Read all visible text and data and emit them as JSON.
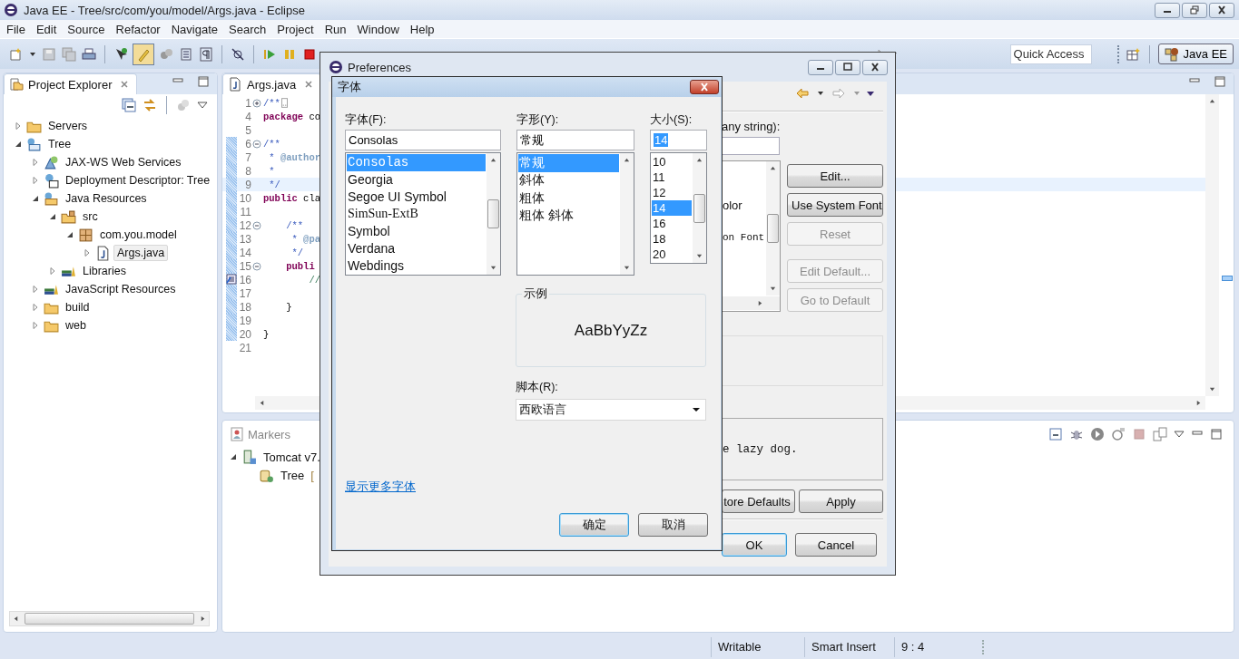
{
  "window": {
    "title": "Java EE - Tree/src/com/you/model/Args.java - Eclipse"
  },
  "menu": [
    "File",
    "Edit",
    "Source",
    "Refactor",
    "Navigate",
    "Search",
    "Project",
    "Run",
    "Window",
    "Help"
  ],
  "toolbar": {
    "quick_access": {
      "placeholder": "Quick Access"
    },
    "perspective": {
      "label": "Java EE",
      "selected": true
    }
  },
  "project_explorer": {
    "title": "Project Explorer",
    "tree": [
      {
        "label": "Servers",
        "kind": "folder",
        "expanded": false,
        "selected": false
      },
      {
        "label": "Tree",
        "kind": "project",
        "expanded": true,
        "selected": false,
        "children": [
          {
            "label": "JAX-WS Web Services",
            "kind": "services",
            "expanded": false,
            "selected": false
          },
          {
            "label": "Deployment Descriptor: Tree",
            "kind": "descriptor",
            "expanded": false,
            "selected": false
          },
          {
            "label": "Java Resources",
            "kind": "resources",
            "expanded": true,
            "selected": false,
            "children": [
              {
                "label": "src",
                "kind": "source",
                "expanded": true,
                "selected": false,
                "children": [
                  {
                    "label": "com.you.model",
                    "kind": "package",
                    "expanded": true,
                    "selected": false,
                    "children": [
                      {
                        "label": "Args.java",
                        "kind": "java",
                        "expanded": false,
                        "selected": true
                      }
                    ]
                  }
                ]
              },
              {
                "label": "Libraries",
                "kind": "library",
                "expanded": false,
                "selected": false
              }
            ]
          },
          {
            "label": "JavaScript Resources",
            "kind": "library",
            "expanded": false,
            "selected": false
          },
          {
            "label": "build",
            "kind": "folder",
            "expanded": false,
            "selected": false
          },
          {
            "label": "web",
            "kind": "folder",
            "expanded": false,
            "selected": false
          }
        ]
      }
    ]
  },
  "editor": {
    "tab": "Args.java",
    "lines": [
      {
        "number": "1",
        "folded": true,
        "changed": false,
        "current": false,
        "code": [
          {
            "text": "/**",
            "kind": "javadoc"
          }
        ]
      },
      {
        "number": "4",
        "changed": false,
        "current": false,
        "code": [
          {
            "text": "package",
            "kind": "keyword"
          },
          {
            "text": " co",
            "kind": "plain"
          }
        ]
      },
      {
        "number": "5",
        "changed": false,
        "current": false
      },
      {
        "number": "6",
        "folded": false,
        "changed": true,
        "current": false,
        "code": [
          {
            "text": "/**",
            "kind": "javadoc"
          }
        ]
      },
      {
        "number": "7",
        "changed": true,
        "current": false,
        "code": [
          {
            "text": " * ",
            "kind": "javadoc"
          },
          {
            "text": "@author",
            "kind": "tag"
          }
        ]
      },
      {
        "number": "8",
        "changed": true,
        "current": false,
        "code": [
          {
            "text": " *",
            "kind": "javadoc"
          }
        ]
      },
      {
        "number": "9",
        "changed": true,
        "current": true,
        "code": [
          {
            "text": " */",
            "kind": "javadoc"
          }
        ]
      },
      {
        "number": "10",
        "changed": true,
        "current": false,
        "code": [
          {
            "text": "public",
            "kind": "keyword"
          },
          {
            "text": " cla",
            "kind": "plain"
          }
        ]
      },
      {
        "number": "11",
        "changed": true,
        "current": false
      },
      {
        "number": "12",
        "folded": false,
        "changed": true,
        "current": false,
        "code": [
          {
            "text": "    /**",
            "kind": "javadoc"
          }
        ]
      },
      {
        "number": "13",
        "changed": true,
        "current": false,
        "code": [
          {
            "text": "     * ",
            "kind": "javadoc"
          },
          {
            "text": "@pa",
            "kind": "tag"
          }
        ]
      },
      {
        "number": "14",
        "changed": true,
        "current": false,
        "code": [
          {
            "text": "     */",
            "kind": "javadoc"
          }
        ]
      },
      {
        "number": "15",
        "folded": false,
        "changed": true,
        "current": false,
        "code": [
          {
            "text": "    publi",
            "kind": "keyword"
          }
        ]
      },
      {
        "number": "16",
        "task_marker": true,
        "changed": true,
        "current": false,
        "code": [
          {
            "text": "        //",
            "kind": "comment"
          }
        ]
      },
      {
        "number": "17",
        "changed": true,
        "current": false
      },
      {
        "number": "18",
        "changed": true,
        "current": false,
        "code": [
          {
            "text": "    }",
            "kind": "plain"
          }
        ]
      },
      {
        "number": "19",
        "changed": true,
        "current": false
      },
      {
        "number": "20",
        "changed": true,
        "current": false,
        "code": [
          {
            "text": "}",
            "kind": "plain"
          }
        ]
      },
      {
        "number": "21",
        "changed": false,
        "current": false
      }
    ]
  },
  "bottom_panel": {
    "tabs": [
      {
        "label": "Markers",
        "selected": false
      }
    ],
    "tree": [
      {
        "label": "Tomcat v7.",
        "kind": "server",
        "expanded": true,
        "children": [
          {
            "label": "Tree",
            "kind": "module",
            "status": "["
          }
        ]
      }
    ]
  },
  "preferences": {
    "title": "Preferences",
    "filter_label": "any string):",
    "list_items": [
      {
        "text": "olor",
        "kind": "sans"
      },
      {
        "text": "on Font",
        "kind": "mono"
      }
    ],
    "buttons": [
      {
        "label": "Edit...",
        "disabled": false
      },
      {
        "label": "Use System Font",
        "disabled": false
      },
      {
        "label": "Reset",
        "disabled": true
      },
      {
        "label": "Edit Default...",
        "disabled": true
      },
      {
        "label": "Go to Default",
        "disabled": true
      }
    ],
    "preview_text": "e lazy dog.",
    "restore_label": "tore Defaults",
    "apply_label": "Apply",
    "ok_label": "OK",
    "cancel_label": "Cancel"
  },
  "font_dialog": {
    "title": "字体",
    "font": {
      "label": "字体(F):",
      "value": "Consolas",
      "items": [
        {
          "text": "Consolas",
          "kind": "mono",
          "selected": true
        },
        {
          "text": "Georgia",
          "kind": "sans",
          "selected": false
        },
        {
          "text": "Segoe UI Symbol",
          "kind": "sans",
          "selected": false
        },
        {
          "text": "SimSun-ExtB",
          "kind": "serif",
          "selected": false
        },
        {
          "text": "Symbol",
          "kind": "sans",
          "selected": false
        },
        {
          "text": "Verdana",
          "kind": "sans",
          "selected": false
        },
        {
          "text": "Webdings",
          "kind": "sans",
          "selected": false
        }
      ]
    },
    "style": {
      "label": "字形(Y):",
      "value": "常规",
      "items": [
        {
          "text": "常规",
          "selected": true
        },
        {
          "text": "斜体",
          "selected": false
        },
        {
          "text": "粗体",
          "selected": false
        },
        {
          "text": "粗体 斜体",
          "selected": false
        }
      ]
    },
    "size": {
      "label": "大小(S):",
      "value": "14",
      "items": [
        {
          "text": "10",
          "selected": false
        },
        {
          "text": "11",
          "selected": false
        },
        {
          "text": "12",
          "selected": false
        },
        {
          "text": "14",
          "selected": true
        },
        {
          "text": "16",
          "selected": false
        },
        {
          "text": "18",
          "selected": false
        },
        {
          "text": "20",
          "selected": false
        }
      ]
    },
    "sample": {
      "legend": "示例",
      "text": "AaBbYyZz"
    },
    "script": {
      "label": "脚本(R):",
      "value": "西欧语言"
    },
    "more_link": "显示更多字体",
    "ok_label": "确定",
    "cancel_label": "取消"
  },
  "status_bar": [
    "Writable",
    "Smart Insert",
    "9 : 4"
  ]
}
